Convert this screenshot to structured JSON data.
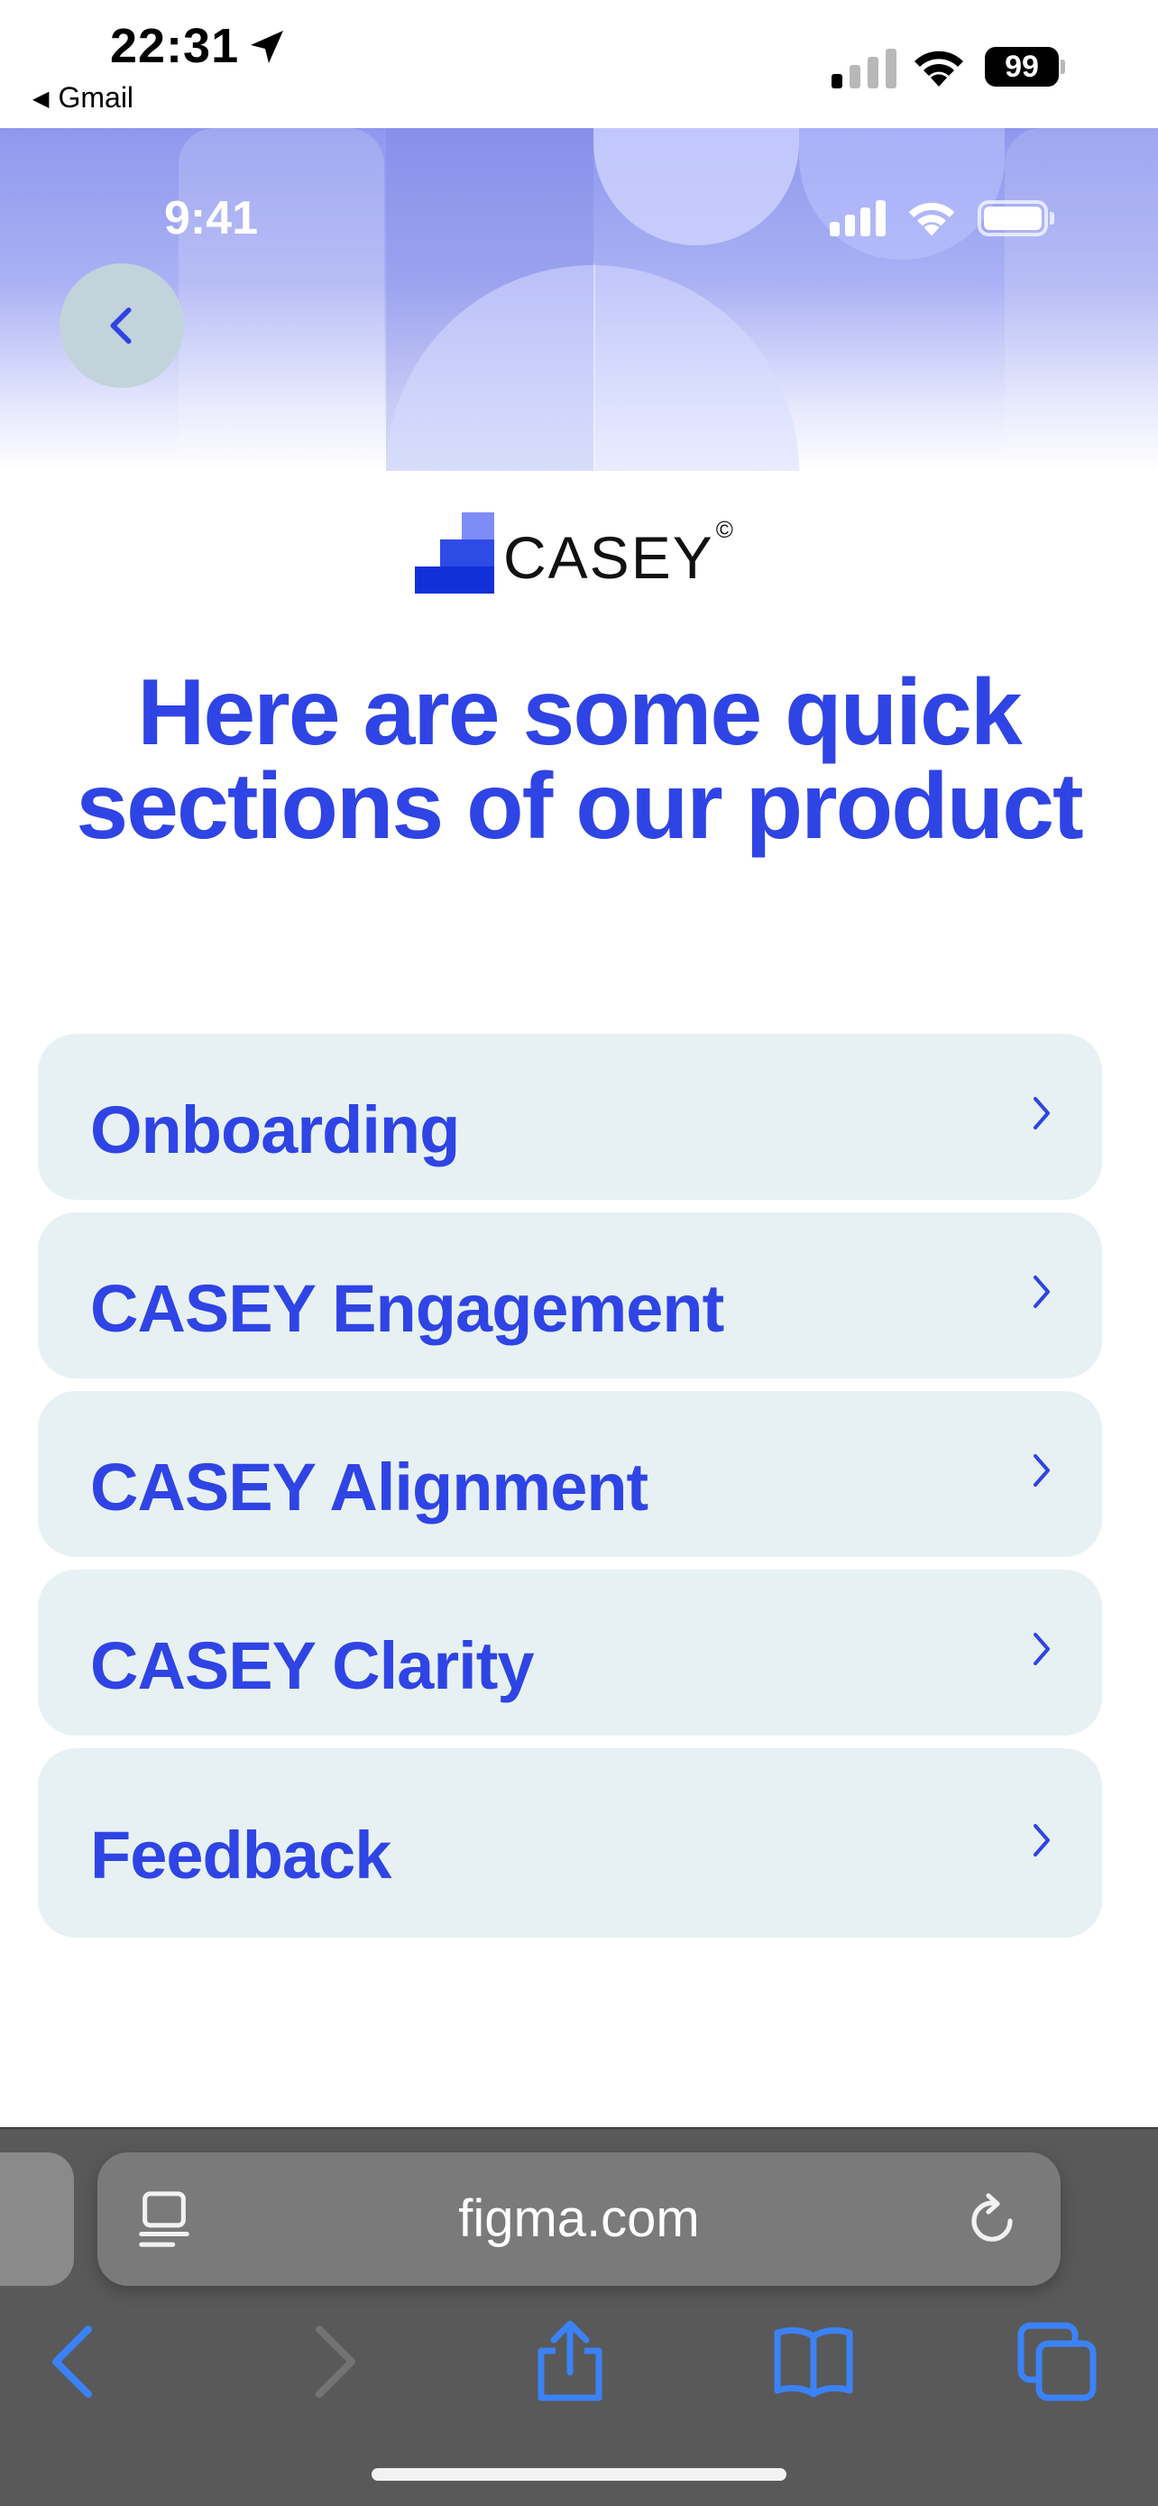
{
  "status_bar": {
    "time": "22:31",
    "back_app": "Gmail",
    "battery": "99"
  },
  "prototype": {
    "inner_time": "9:41",
    "logo_text": "CASEY",
    "logo_mark": "©",
    "headline_line1": "Here are some quick",
    "headline_line2": "sections of our product",
    "sections": [
      {
        "label": "Onboarding"
      },
      {
        "label": "CASEY Engagement"
      },
      {
        "label": "CASEY Alignment"
      },
      {
        "label": "CASEY Clarity"
      },
      {
        "label": "Feedback"
      }
    ]
  },
  "browser": {
    "url": "figma.com"
  },
  "colors": {
    "accent": "#2f44e4",
    "card_bg": "#e7f1f4",
    "toolbar_icon": "#3b82f6"
  },
  "icons": {
    "location": "location-arrow-icon",
    "signal": "cellular-signal-icon",
    "wifi": "wifi-icon",
    "battery": "battery-icon",
    "back": "chevron-left-icon",
    "section_chevron": "chevron-right-icon",
    "reader": "reader-mode-icon",
    "reload": "reload-icon",
    "share": "share-icon",
    "bookmarks": "book-icon",
    "tabs": "tabs-icon"
  }
}
